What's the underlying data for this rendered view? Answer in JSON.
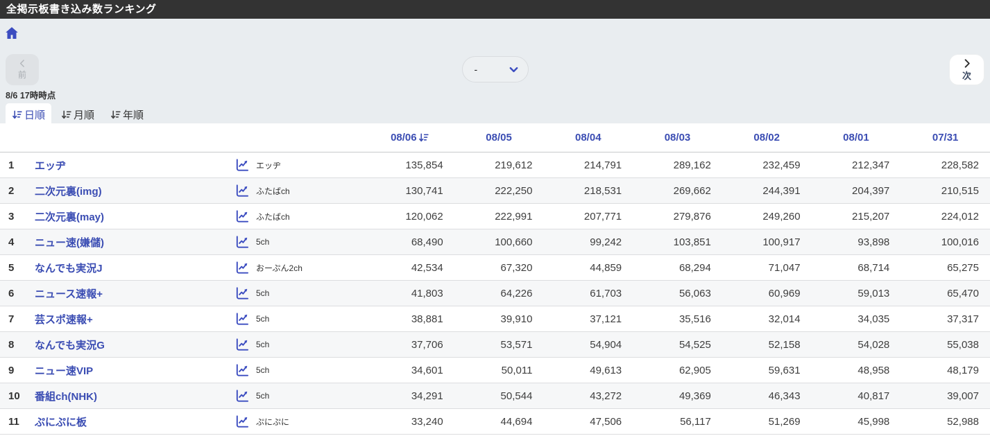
{
  "header": {
    "title": "全掲示板書き込み数ランキング"
  },
  "toolbar": {
    "prev_label": "前",
    "next_label": "次",
    "period_dropdown_value": "-",
    "timestamp": "8/6 17時時点"
  },
  "tabs": [
    {
      "key": "daily",
      "label": "日順",
      "active": true
    },
    {
      "key": "monthly",
      "label": "月順",
      "active": false
    },
    {
      "key": "yearly",
      "label": "年順",
      "active": false
    }
  ],
  "icons": {
    "home": "house",
    "prev": "chevron-left",
    "next": "chevron-right",
    "dropdown": "chevron-down",
    "sort": "sort-descending",
    "chart": "line-chart"
  },
  "table": {
    "date_columns": [
      "08/06",
      "08/05",
      "08/04",
      "08/03",
      "08/02",
      "08/01",
      "07/31"
    ],
    "sorted_column_index": 0,
    "rows": [
      {
        "rank": "1",
        "name": "エッヂ",
        "site": "エッヂ",
        "values": [
          "135,854",
          "219,612",
          "214,791",
          "289,162",
          "232,459",
          "212,347",
          "228,582"
        ]
      },
      {
        "rank": "2",
        "name": "二次元裏(img)",
        "site": "ふたばch",
        "values": [
          "130,741",
          "222,250",
          "218,531",
          "269,662",
          "244,391",
          "204,397",
          "210,515"
        ]
      },
      {
        "rank": "3",
        "name": "二次元裏(may)",
        "site": "ふたばch",
        "values": [
          "120,062",
          "222,991",
          "207,771",
          "279,876",
          "249,260",
          "215,207",
          "224,012"
        ]
      },
      {
        "rank": "4",
        "name": "ニュー速(嫌儲)",
        "site": "5ch",
        "values": [
          "68,490",
          "100,660",
          "99,242",
          "103,851",
          "100,917",
          "93,898",
          "100,016"
        ]
      },
      {
        "rank": "5",
        "name": "なんでも実況J",
        "site": "おーぷん2ch",
        "values": [
          "42,534",
          "67,320",
          "44,859",
          "68,294",
          "71,047",
          "68,714",
          "65,275"
        ]
      },
      {
        "rank": "6",
        "name": "ニュース速報+",
        "site": "5ch",
        "values": [
          "41,803",
          "64,226",
          "61,703",
          "56,063",
          "60,969",
          "59,013",
          "65,470"
        ]
      },
      {
        "rank": "7",
        "name": "芸スポ速報+",
        "site": "5ch",
        "values": [
          "38,881",
          "39,910",
          "37,121",
          "35,516",
          "32,014",
          "34,035",
          "37,317"
        ]
      },
      {
        "rank": "8",
        "name": "なんでも実況G",
        "site": "5ch",
        "values": [
          "37,706",
          "53,571",
          "54,904",
          "54,525",
          "52,158",
          "54,028",
          "55,038"
        ]
      },
      {
        "rank": "9",
        "name": "ニュー速VIP",
        "site": "5ch",
        "values": [
          "34,601",
          "50,011",
          "49,613",
          "62,905",
          "59,631",
          "48,958",
          "48,179"
        ]
      },
      {
        "rank": "10",
        "name": "番組ch(NHK)",
        "site": "5ch",
        "values": [
          "34,291",
          "50,544",
          "43,272",
          "49,369",
          "46,343",
          "40,817",
          "39,007"
        ]
      },
      {
        "rank": "11",
        "name": "ぷにぷに板",
        "site": "ぷにぷに",
        "values": [
          "33,240",
          "44,694",
          "47,506",
          "56,117",
          "51,269",
          "45,998",
          "52,988"
        ]
      }
    ]
  },
  "colors": {
    "accent_blue": "#3b4cc0",
    "link_blue": "#3b4db3",
    "header_bg": "#333333",
    "page_bg": "#e9edf0"
  }
}
